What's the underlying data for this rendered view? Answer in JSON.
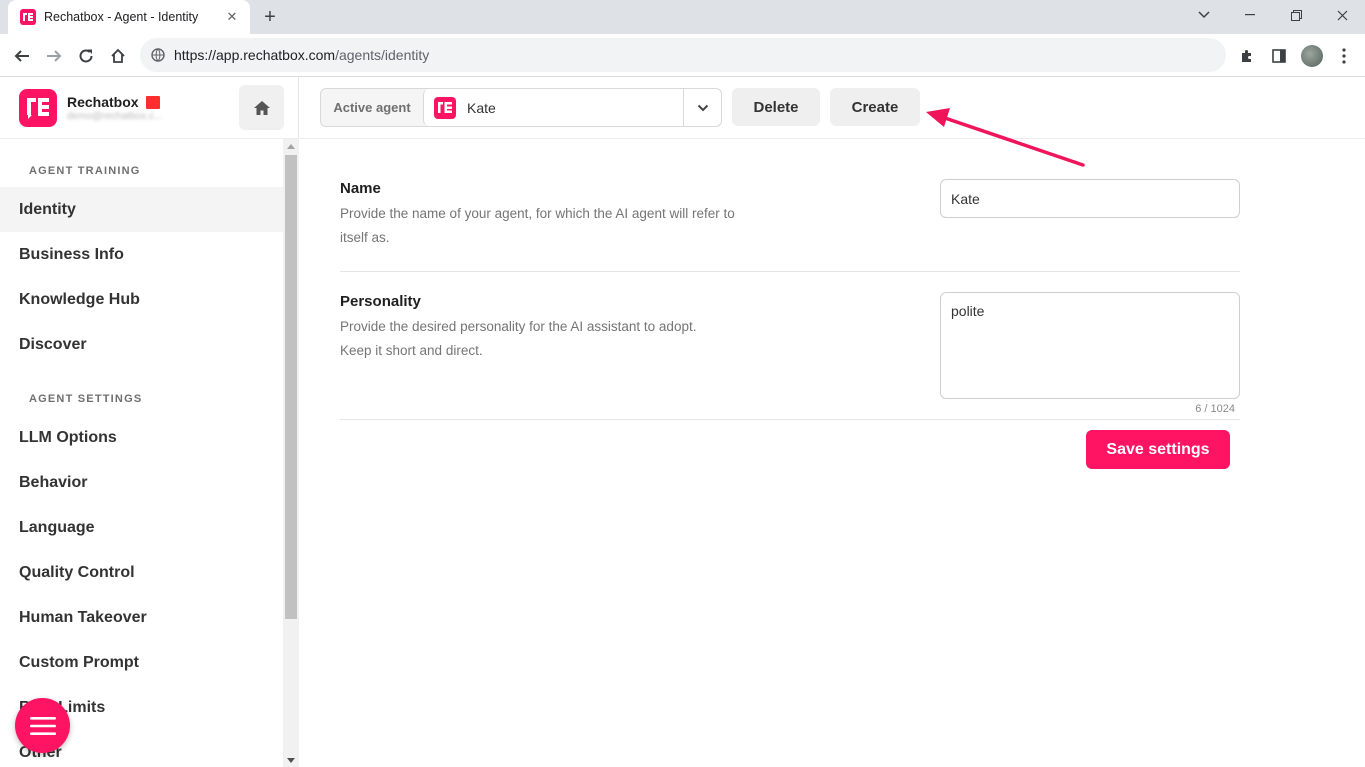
{
  "browser": {
    "tab_title": "Rechatbox - Agent - Identity",
    "tab_close": "✕",
    "new_tab": "+",
    "url_host": "https://app.rechatbox.com",
    "url_path": "/agents/identity"
  },
  "brand": {
    "name": "Rechatbox",
    "email": "demo@rechatbox.c..."
  },
  "sidebar": {
    "section_training": "AGENT TRAINING",
    "training_items": [
      {
        "label": "Identity",
        "active": true
      },
      {
        "label": "Business Info"
      },
      {
        "label": "Knowledge Hub"
      },
      {
        "label": "Discover"
      }
    ],
    "section_settings": "AGENT SETTINGS",
    "settings_items": [
      {
        "label": "LLM Options"
      },
      {
        "label": "Behavior"
      },
      {
        "label": "Language"
      },
      {
        "label": "Quality Control"
      },
      {
        "label": "Human Takeover"
      },
      {
        "label": "Custom Prompt"
      },
      {
        "label": "Rate Limits"
      },
      {
        "label": "Other"
      }
    ]
  },
  "header": {
    "active_agent_label": "Active agent",
    "selected_agent": "Kate",
    "delete_label": "Delete",
    "create_label": "Create"
  },
  "form": {
    "name": {
      "title": "Name",
      "description": "Provide the name of your agent, for which the AI agent will refer to itself as.",
      "value": "Kate"
    },
    "personality": {
      "title": "Personality",
      "description": "Provide the desired personality for the AI assistant to adopt. Keep it short and direct.",
      "value": "polite",
      "counter": "6 / 1024"
    },
    "save_label": "Save settings"
  },
  "colors": {
    "brand_pink": "#ff1464",
    "annotation_arrow": "#f0145a"
  }
}
